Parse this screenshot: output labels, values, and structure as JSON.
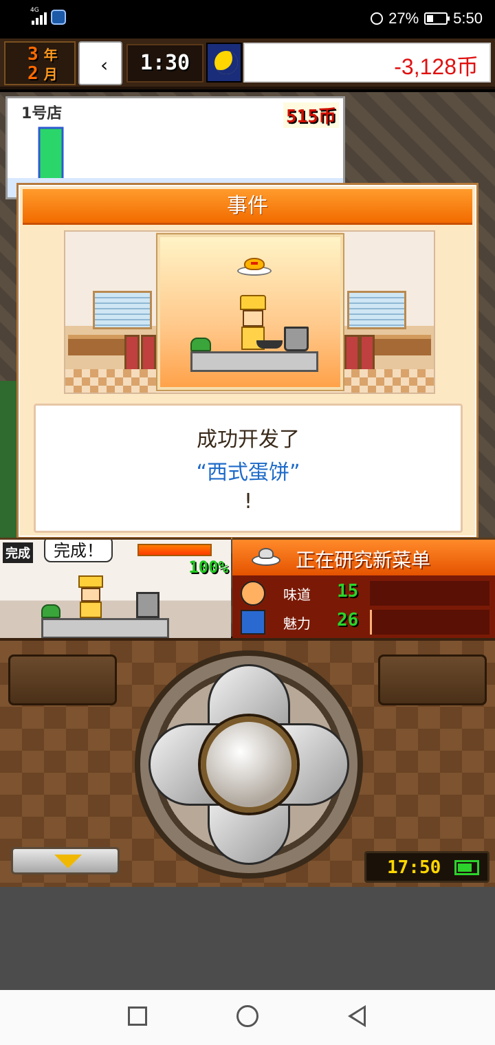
{
  "status_bar": {
    "network": "4G",
    "battery_percent": "27%",
    "time": "5:50"
  },
  "top_bar": {
    "year_num": "3",
    "year_unit": "年",
    "month_num": "2",
    "month_unit": "月",
    "clock_time": "1:30",
    "money": "-3,128币"
  },
  "store": {
    "name": "1号店",
    "sales": "515币",
    "chart_level": 0.9
  },
  "event": {
    "title": "事件",
    "line1": "成功开发了",
    "line2": "“西式蛋饼”",
    "line3": "!"
  },
  "kitchen": {
    "done_tag": "完成",
    "done_bubble": "完成！",
    "progress_text": "100%",
    "progress_value": 1.0
  },
  "research": {
    "title": "正在研究新菜单",
    "stats": [
      {
        "label": "味道",
        "value": "15",
        "icon": "taste-icon",
        "level": 0.0
      },
      {
        "label": "魅力",
        "value": "26",
        "icon": "charm-icon",
        "level": 0.01
      }
    ]
  },
  "controller": {
    "game_clock": "17:50"
  }
}
